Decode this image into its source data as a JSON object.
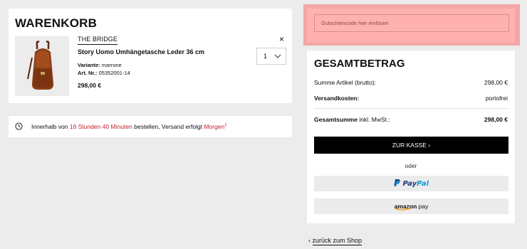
{
  "cart": {
    "title": "WARENKORB",
    "item": {
      "brand": "THE BRIDGE",
      "name": "Story Uomo Umhängetasche Leder 36 cm",
      "variant_label": "Variante:",
      "variant_value": "marrone",
      "art_label": "Art. Nr.:",
      "art_value": "05352001-14",
      "price": "298,00 €",
      "quantity": "1",
      "remove_symbol": "×"
    }
  },
  "shipping_notice": {
    "prefix": "Innerhalb von ",
    "time": "16 Stunden 40 Minuten",
    "middle": " bestellen, Versand erfolgt ",
    "day": "Morgen",
    "footnote": "1"
  },
  "coupon": {
    "placeholder": "Gutscheincode hier einlösen"
  },
  "total": {
    "title": "GESAMTBETRAG",
    "subtotal_label": "Summe Artikel (brutto):",
    "subtotal_value": "298,00 €",
    "shipping_label": "Versandkosten:",
    "shipping_value": "portofrei",
    "grand_label": "Gesamtsumme",
    "grand_suffix": " inkl. MwSt.:",
    "grand_value": "298,00 €",
    "checkout_label": "ZUR KASSE",
    "checkout_chevron": "›",
    "or_label": "oder",
    "paypal_pay": "Pay",
    "paypal_pal": "Pal",
    "amazon_word": "amazon",
    "amazon_pay": " pay"
  },
  "back_link": {
    "chevron": "‹",
    "label": "zurück zum Shop"
  },
  "colors": {
    "accent_red": "#c0212b",
    "highlight": "#ff4646",
    "paypal_dark": "#253b80",
    "paypal_light": "#179bd7",
    "amazon_orange": "#f79400"
  },
  "icons": {
    "clock": "clock-icon",
    "chevron_down": "chevron-down-icon",
    "remove": "close-icon",
    "product_image": "shoulder-bag-image"
  }
}
